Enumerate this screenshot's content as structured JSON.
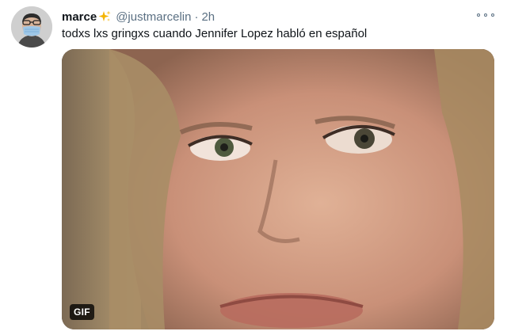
{
  "tweet": {
    "author_name": "marce",
    "handle": "@justmarcelin",
    "separator": "·",
    "time": "2h",
    "text": "todxs lxs gringxs cuando Jennifer Lopez habló en español",
    "media_badge": "GIF",
    "avatar_icon": "user-avatar-with-mask",
    "name_emoji_icon": "sparkles-icon",
    "more_icon": "more-options-icon"
  },
  "colors": {
    "text_primary": "#0f1419",
    "text_secondary": "#5b7083",
    "sparkle": "#f4b400",
    "badge_bg": "#000000"
  }
}
